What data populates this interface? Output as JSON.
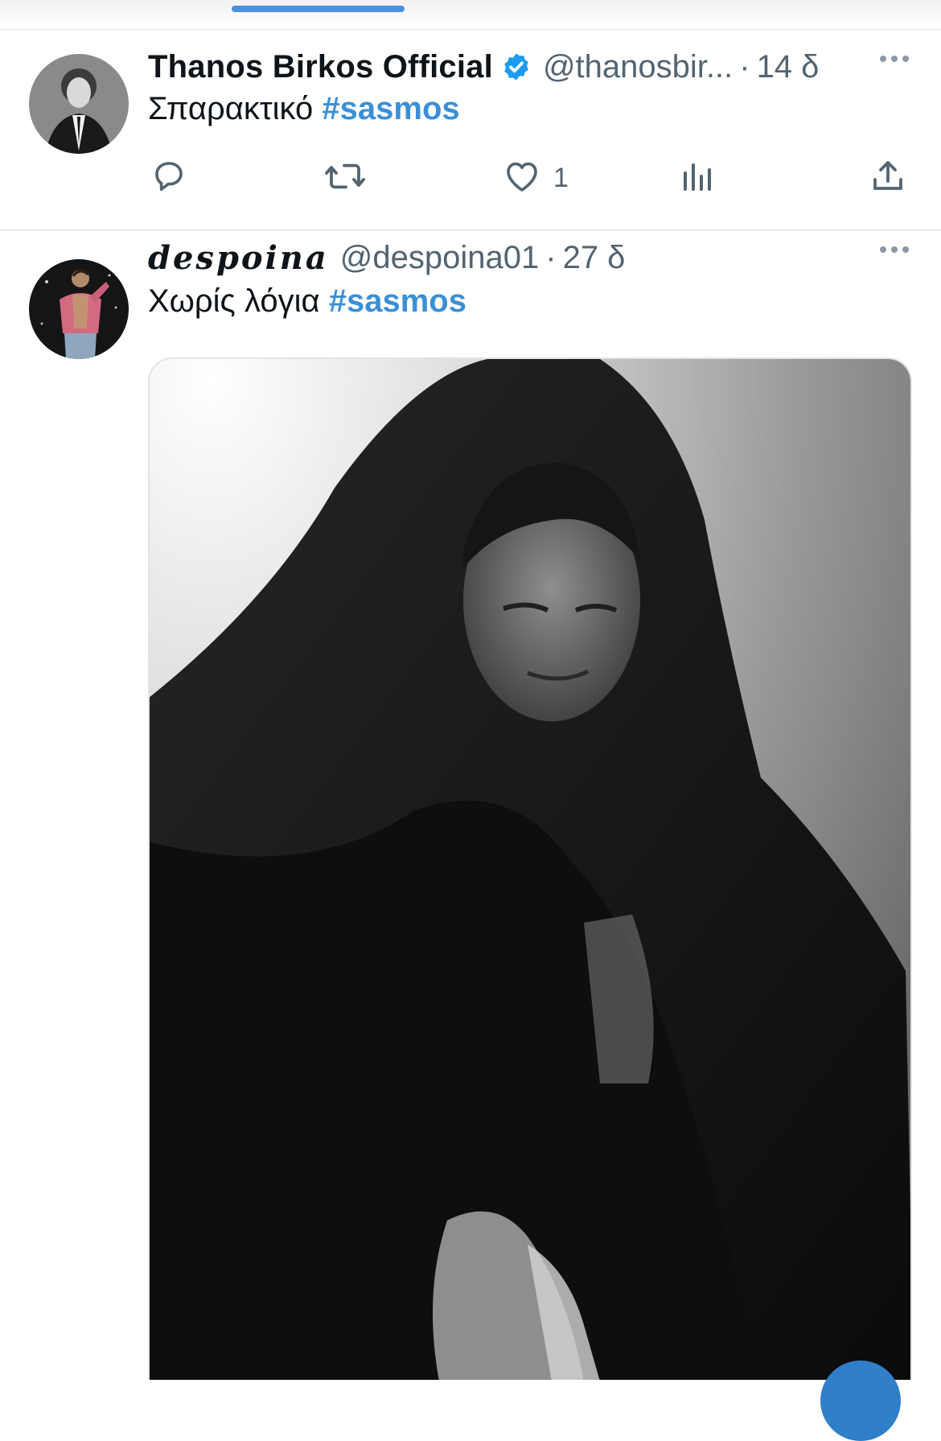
{
  "tweets": [
    {
      "author": "Thanos Birkos Official",
      "verified": true,
      "handle": "@thanosbir...",
      "time": "14 δ",
      "text": "Σπαρακτικό",
      "hashtag": "#sasmos",
      "likes": "1"
    },
    {
      "author": "despoina",
      "handle": "@despoina01",
      "time": "27 δ",
      "text": "Χωρίς λόγια",
      "hashtag": "#sasmos",
      "media": "black-and-white photo of a woman in a dark headscarf looking down"
    }
  ],
  "separator": "·",
  "colors": {
    "accent": "#4a90e2",
    "hashtag": "#3b8fd6",
    "verified": "#1d9bf0",
    "muted": "#536471"
  },
  "icons": [
    "reply-icon",
    "retweet-icon",
    "like-icon",
    "views-icon",
    "share-icon",
    "more-icon",
    "verified-icon"
  ]
}
